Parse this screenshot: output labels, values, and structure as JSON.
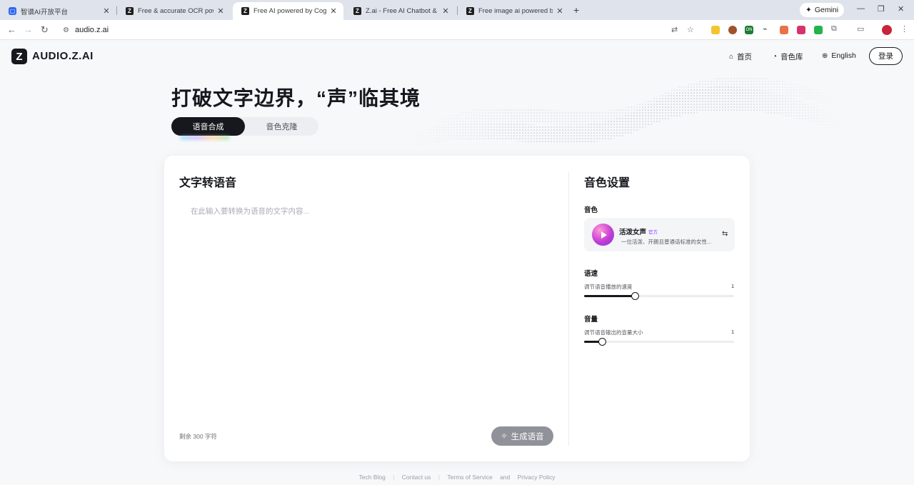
{
  "browser": {
    "tabs": [
      {
        "title": "智谱AI开放平台",
        "active": false
      },
      {
        "title": "Free & accurate OCR powere",
        "active": false
      },
      {
        "title": "Free AI powered by CogTTS",
        "active": true
      },
      {
        "title": "Z.ai - Free AI Chatbot & Agen",
        "active": false
      },
      {
        "title": "Free image ai powered by GL",
        "active": false
      }
    ],
    "gemini_label": "Gemini",
    "url": "audio.z.ai",
    "ext_on_label": "ON"
  },
  "site": {
    "logo_letter": "Z",
    "logo_text": "AUDIO.Z.AI",
    "nav": {
      "home": "首页",
      "voice_library": "音色库",
      "language": "English"
    },
    "login": "登录"
  },
  "hero": {
    "title": "打破文字边界，“声”临其境",
    "tabs": [
      "语音合成",
      "音色克隆"
    ],
    "active_tab": 0
  },
  "tts": {
    "title": "文字转语音",
    "placeholder": "在此输入要转换为语音的文字内容...",
    "remaining": "剩余 300 字符",
    "generate": "生成语音"
  },
  "voice_settings": {
    "title": "音色设置",
    "voice_label": "音色",
    "voice": {
      "name": "活泼女声",
      "tag": "官方",
      "desc": "一位活泼、开朗且普通话标准的女性..."
    },
    "speed": {
      "label": "语速",
      "desc": "调节语音播放的速度",
      "value": "1",
      "fraction": 0.34
    },
    "volume": {
      "label": "音量",
      "desc": "调节语音输出的音量大小",
      "value": "1",
      "fraction": 0.12
    }
  },
  "footer": {
    "links": [
      "Tech Blog",
      "Contact us",
      "Terms of Service",
      "Privacy Policy"
    ],
    "and": "and"
  },
  "colors": {
    "accent": "#16181d",
    "button_disabled": "#8f9299",
    "voice_tag": "#8a3ffc"
  }
}
